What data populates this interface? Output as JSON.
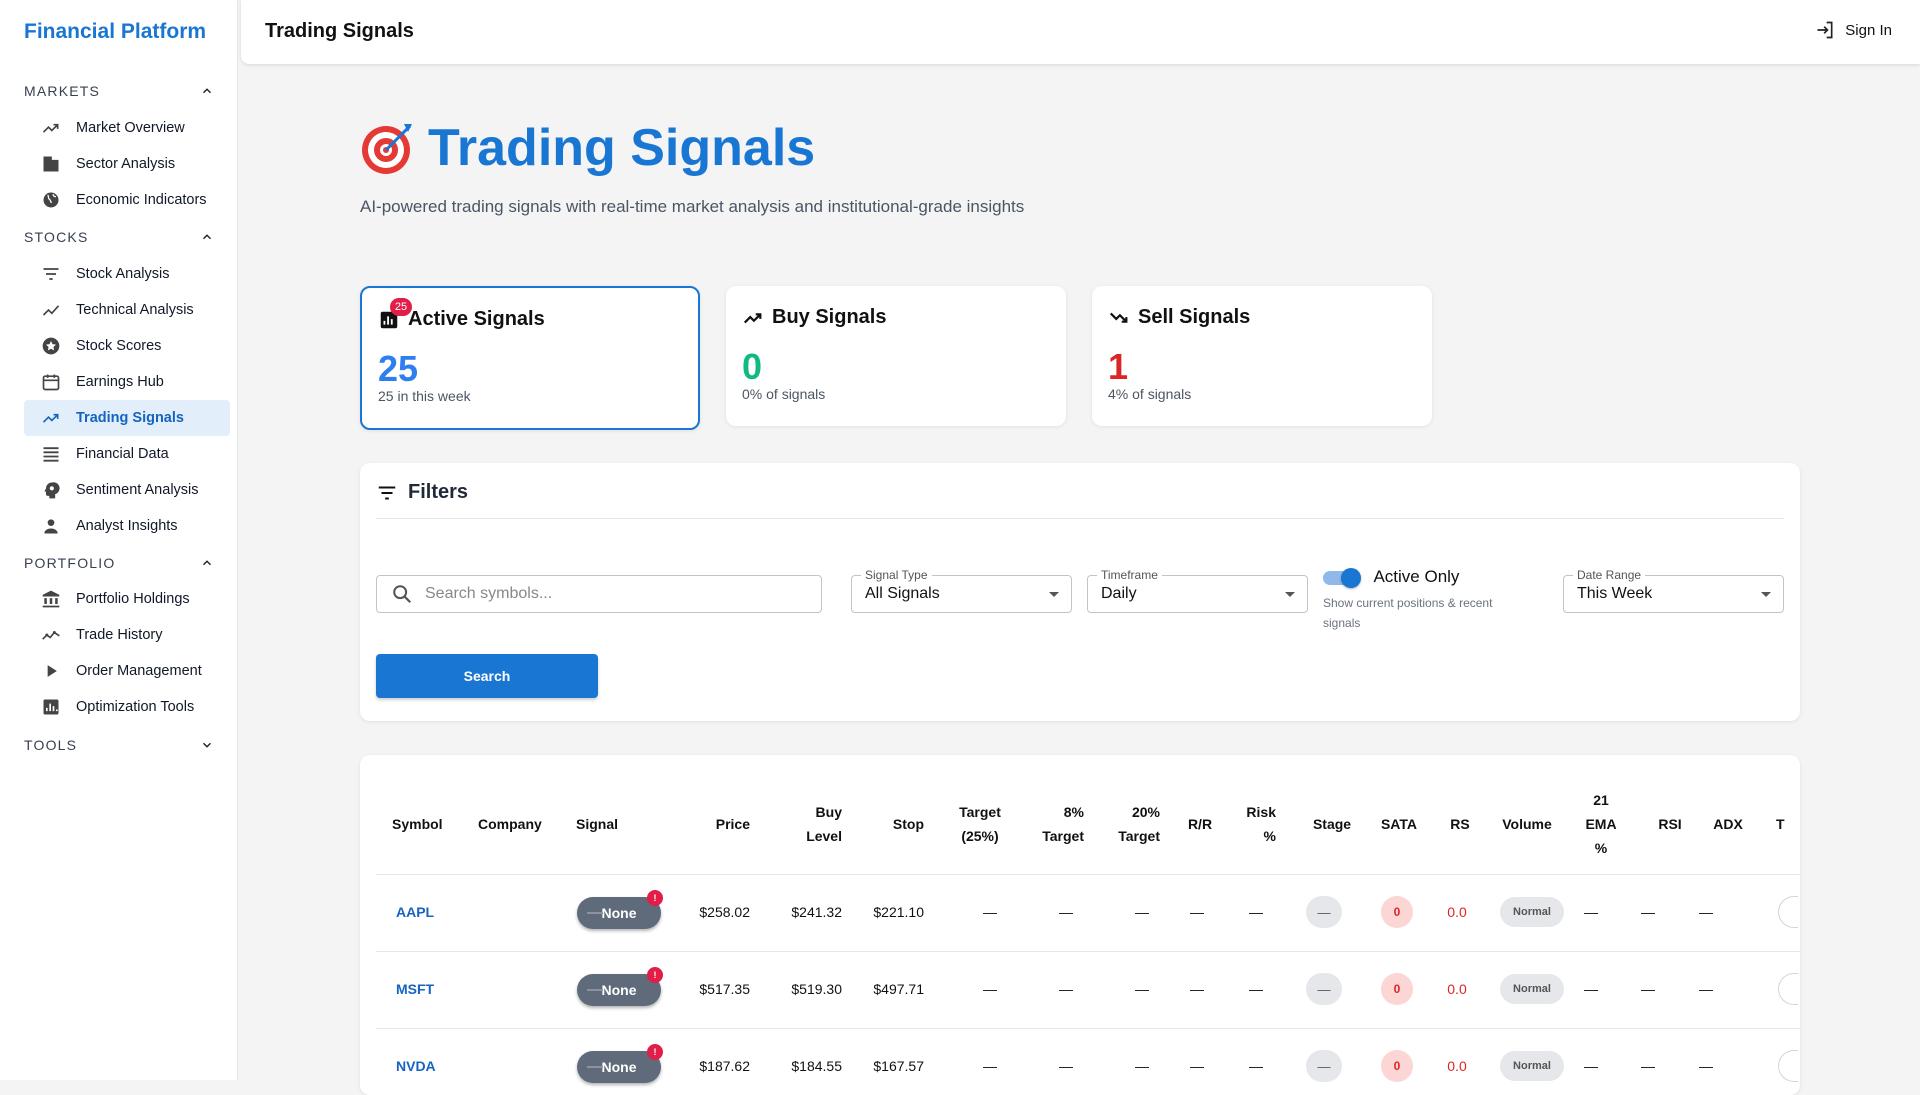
{
  "app": {
    "brand": "Financial Platform",
    "page_header": "Trading Signals",
    "sign_in": "Sign In"
  },
  "sidebar": {
    "sections": [
      {
        "label": "MARKETS",
        "state": "expanded",
        "items": [
          {
            "label": "Market Overview",
            "icon": "trending-up-icon"
          },
          {
            "label": "Sector Analysis",
            "icon": "building-icon"
          },
          {
            "label": "Economic Indicators",
            "icon": "globe-icon"
          }
        ]
      },
      {
        "label": "STOCKS",
        "state": "expanded",
        "items": [
          {
            "label": "Stock Analysis",
            "icon": "filter-icon"
          },
          {
            "label": "Technical Analysis",
            "icon": "show-chart-icon"
          },
          {
            "label": "Stock Scores",
            "icon": "star-circle-icon"
          },
          {
            "label": "Earnings Hub",
            "icon": "calendar-icon"
          },
          {
            "label": "Trading Signals",
            "icon": "trending-up-icon",
            "active": true
          },
          {
            "label": "Financial Data",
            "icon": "list-icon"
          },
          {
            "label": "Sentiment Analysis",
            "icon": "psychology-icon"
          },
          {
            "label": "Analyst Insights",
            "icon": "person-icon"
          }
        ]
      },
      {
        "label": "PORTFOLIO",
        "state": "expanded",
        "items": [
          {
            "label": "Portfolio Holdings",
            "icon": "bank-icon"
          },
          {
            "label": "Trade History",
            "icon": "timeline-icon"
          },
          {
            "label": "Order Management",
            "icon": "play-icon"
          },
          {
            "label": "Optimization Tools",
            "icon": "analytics-icon"
          }
        ]
      },
      {
        "label": "TOOLS",
        "state": "collapsed",
        "items": []
      }
    ]
  },
  "hero": {
    "title": "Trading Signals",
    "subtitle": "AI-powered trading signals with real-time market analysis and institutional-grade insights",
    "icon": "target-icon"
  },
  "cards": [
    {
      "title": "Active Signals",
      "value": "25",
      "note": "25 in this week",
      "badge": "25",
      "color": "#1976d2",
      "icon": "analytics-icon",
      "selected": true
    },
    {
      "title": "Buy Signals",
      "value": "0",
      "note": "0% of signals",
      "color": "#10b981",
      "icon": "trending-up-icon"
    },
    {
      "title": "Sell Signals",
      "value": "1",
      "note": "4% of signals",
      "color": "#dc2626",
      "icon": "trending-down-icon"
    }
  ],
  "filters": {
    "title": "Filters",
    "search_placeholder": "Search symbols...",
    "search_value": "",
    "signal_type": {
      "label": "Signal Type",
      "value": "All Signals"
    },
    "timeframe": {
      "label": "Timeframe",
      "value": "Daily"
    },
    "active_only": {
      "label": "Active Only",
      "help": "Show current positions & recent signals",
      "checked": true
    },
    "date_range": {
      "label": "Date Range",
      "value": "This Week"
    },
    "search_button": "Search"
  },
  "table": {
    "headers": {
      "symbol": "Symbol",
      "company": "Company",
      "signal": "Signal",
      "price": "Price",
      "buy_level_1": "Buy",
      "buy_level_2": "Level",
      "stop": "Stop",
      "target25_1": "Target",
      "target25_2": "(25%)",
      "target8_1": "8%",
      "target8_2": "Target",
      "target20_1": "20%",
      "target20_2": "Target",
      "rr": "R/R",
      "risk_1": "Risk",
      "risk_2": "%",
      "stage": "Stage",
      "sata": "SATA",
      "rs": "RS",
      "volume": "Volume",
      "ema_1": "21",
      "ema_2": "EMA",
      "ema_3": "%",
      "rsi": "RSI",
      "adx": "ADX",
      "t": "T"
    },
    "rows": [
      {
        "symbol": "AAPL",
        "company": "",
        "signal": "None",
        "price": "$258.02",
        "buy_level": "$241.32",
        "stop": "$221.10",
        "target25": "—",
        "target8": "—",
        "target20": "—",
        "rr": "—",
        "risk": "—",
        "stage": "—",
        "sata": "0",
        "rs": "0.0",
        "volume": "Normal",
        "ema": "—",
        "rsi": "—",
        "adx": "—"
      },
      {
        "symbol": "MSFT",
        "company": "",
        "signal": "None",
        "price": "$517.35",
        "buy_level": "$519.30",
        "stop": "$497.71",
        "target25": "—",
        "target8": "—",
        "target20": "—",
        "rr": "—",
        "risk": "—",
        "stage": "—",
        "sata": "0",
        "rs": "0.0",
        "volume": "Normal",
        "ema": "—",
        "rsi": "—",
        "adx": "—"
      },
      {
        "symbol": "NVDA",
        "company": "",
        "signal": "None",
        "price": "$187.62",
        "buy_level": "$184.55",
        "stop": "$167.57",
        "target25": "—",
        "target8": "—",
        "target20": "—",
        "rr": "—",
        "risk": "—",
        "stage": "—",
        "sata": "0",
        "rs": "0.0",
        "volume": "Normal",
        "ema": "—",
        "rsi": "—",
        "adx": "—"
      }
    ]
  }
}
